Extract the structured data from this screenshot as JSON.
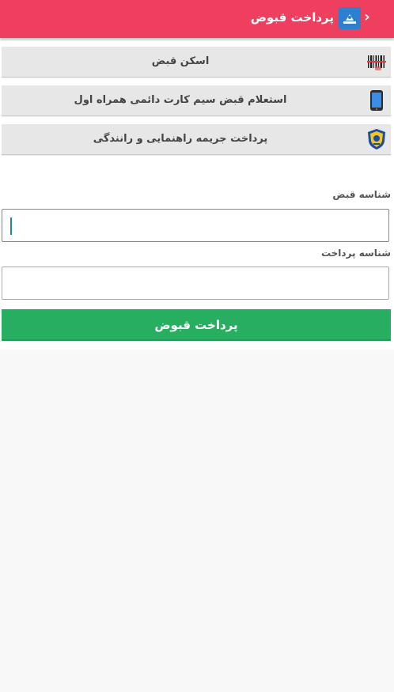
{
  "header": {
    "title": "پرداخت قبوض",
    "back_icon": "chevron-icon",
    "logo_icon": "bill-payment-logo-icon",
    "color": "#ee3f5e"
  },
  "menu": {
    "items": [
      {
        "label": "اسکن قبض",
        "icon": "barcode-scanner-icon"
      },
      {
        "label": "استعلام قبض سیم کارت دائمی همراه اول",
        "icon": "mobile-phone-icon"
      },
      {
        "label": "پرداخت جریمه راهنمایی و رانندگی",
        "icon": "traffic-police-badge-icon"
      }
    ]
  },
  "form": {
    "bill_id": {
      "label": "شناسه قبض",
      "value": "",
      "placeholder": ""
    },
    "payment_id": {
      "label": "شناسه پرداخت",
      "value": "",
      "placeholder": ""
    },
    "submit_label": "پرداخت قبوض",
    "submit_color": "#27ae60"
  }
}
